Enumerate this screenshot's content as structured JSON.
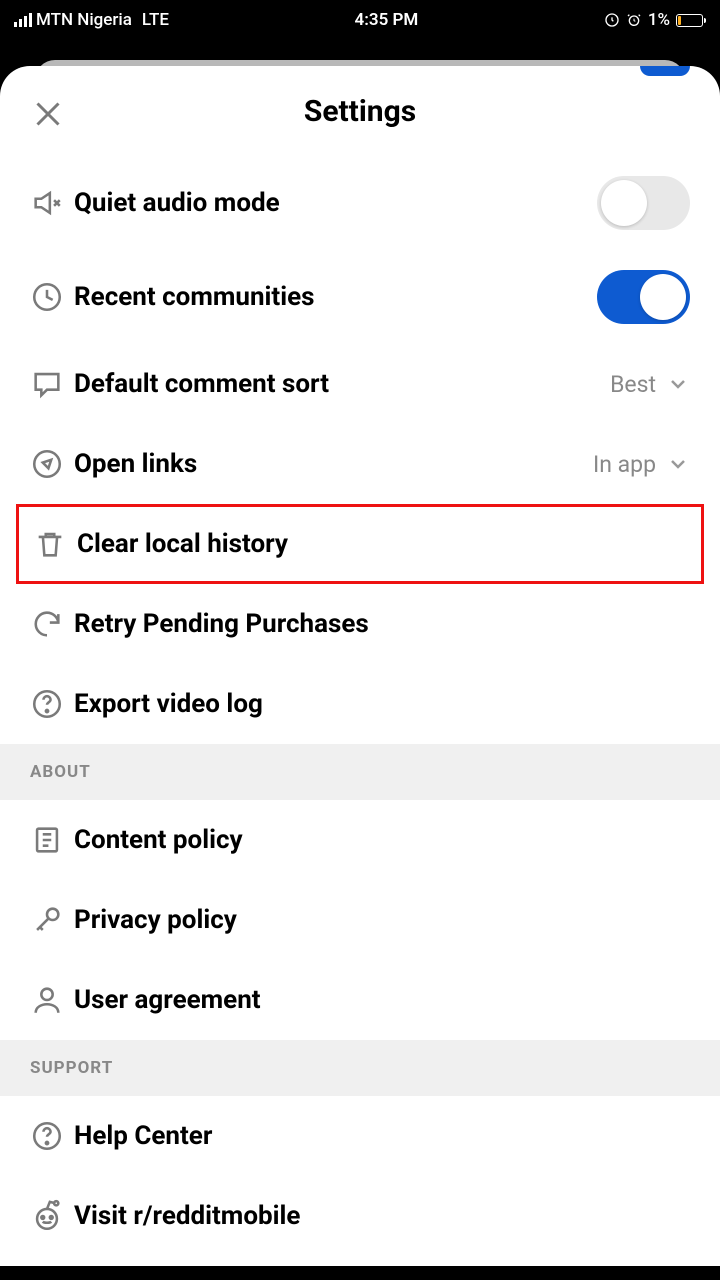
{
  "statusBar": {
    "carrier": "MTN Nigeria",
    "network": "LTE",
    "time": "4:35 PM",
    "battery": "1%"
  },
  "header": {
    "title": "Settings"
  },
  "rows": {
    "quietAudio": {
      "label": "Quiet audio mode"
    },
    "recentCommunities": {
      "label": "Recent communities"
    },
    "commentSort": {
      "label": "Default comment sort",
      "value": "Best"
    },
    "openLinks": {
      "label": "Open links",
      "value": "In app"
    },
    "clearHistory": {
      "label": "Clear local history"
    },
    "retryPurchases": {
      "label": "Retry Pending Purchases"
    },
    "exportVideo": {
      "label": "Export video log"
    },
    "contentPolicy": {
      "label": "Content policy"
    },
    "privacyPolicy": {
      "label": "Privacy policy"
    },
    "userAgreement": {
      "label": "User agreement"
    },
    "helpCenter": {
      "label": "Help Center"
    },
    "visitReddit": {
      "label": "Visit r/redditmobile"
    }
  },
  "sections": {
    "about": "ABOUT",
    "support": "SUPPORT"
  }
}
